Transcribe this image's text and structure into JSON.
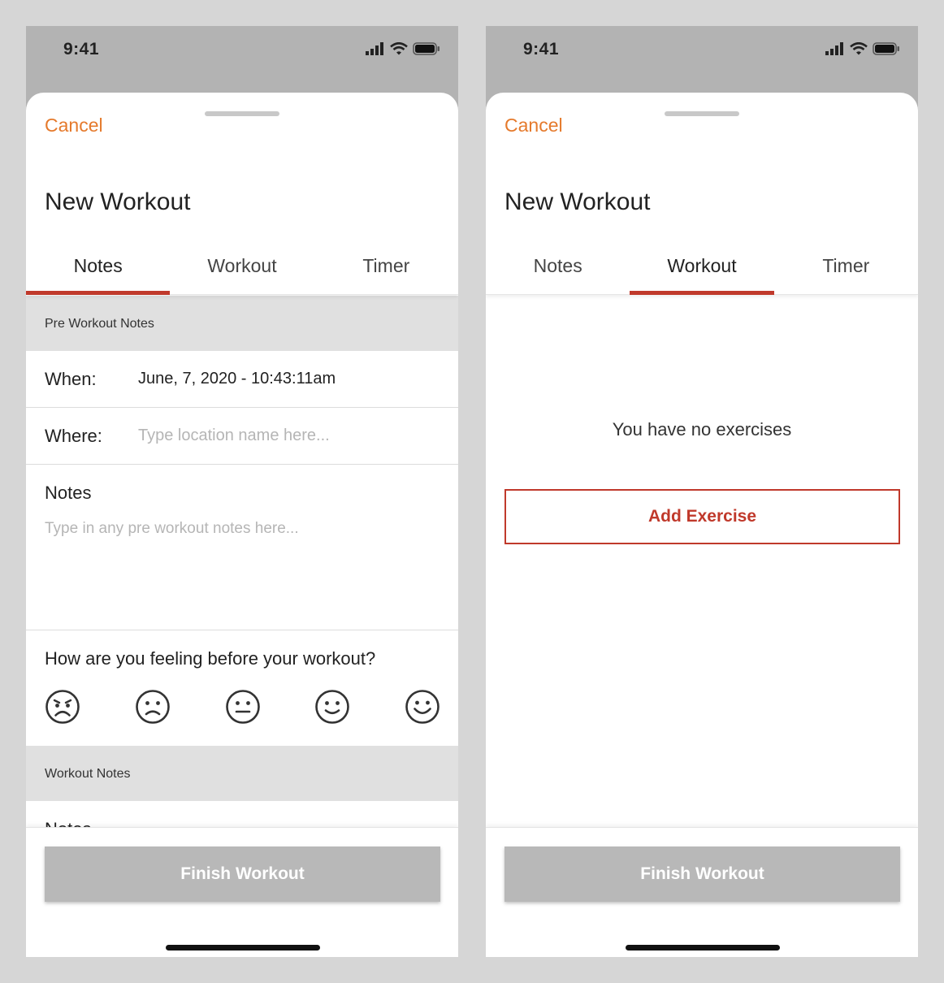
{
  "status_bar": {
    "time": "9:41"
  },
  "colors": {
    "accent_orange": "#e57a2c",
    "accent_red": "#c0392b",
    "button_disabled": "#b8b8b8"
  },
  "left_screen": {
    "cancel_label": "Cancel",
    "title": "New Workout",
    "tabs": [
      {
        "label": "Notes",
        "active": true
      },
      {
        "label": "Workout",
        "active": false
      },
      {
        "label": "Timer",
        "active": false
      }
    ],
    "pre_workout_header": "Pre Workout Notes",
    "when_label": "When:",
    "when_value": "June, 7, 2020 - 10:43:11am",
    "where_label": "Where:",
    "where_placeholder": "Type location name here...",
    "notes_label": "Notes",
    "notes_placeholder": "Type in any pre workout notes here...",
    "feeling_question": "How are you feeling before your workout?",
    "moods": [
      "very-sad-icon",
      "sad-icon",
      "neutral-icon",
      "happy-icon",
      "very-happy-icon"
    ],
    "workout_notes_header": "Workout Notes",
    "workout_notes_label": "Notes",
    "finish_label": "Finish Workout"
  },
  "right_screen": {
    "cancel_label": "Cancel",
    "title": "New Workout",
    "tabs": [
      {
        "label": "Notes",
        "active": false
      },
      {
        "label": "Workout",
        "active": true
      },
      {
        "label": "Timer",
        "active": false
      }
    ],
    "empty_message": "You have no exercises",
    "add_exercise_label": "Add Exercise",
    "finish_label": "Finish Workout"
  }
}
